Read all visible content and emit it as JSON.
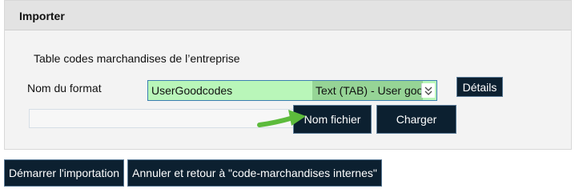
{
  "panel": {
    "title": "Importer",
    "subtitle": "Table codes marchandises de l’entreprise",
    "format": {
      "label": "Nom du format",
      "selected_name": "UserGoodcodes",
      "selected_type": "Text (TAB) - User goo"
    },
    "details_button": "Détails",
    "filename_button": "Nom fichier",
    "load_button": "Charger"
  },
  "actions": {
    "start_import": "Démarrer l'importation",
    "cancel_return": "Annuler et retour à \"code-marchandises internes\""
  },
  "colors": {
    "button_bg": "#0c2030",
    "select_bg": "#b9f6b9",
    "select_highlight": "#96d496",
    "arrow": "#5dbb3c"
  },
  "icons": {
    "dropdown": "chevron-down-icon",
    "pointer": "green-arrow-icon"
  }
}
